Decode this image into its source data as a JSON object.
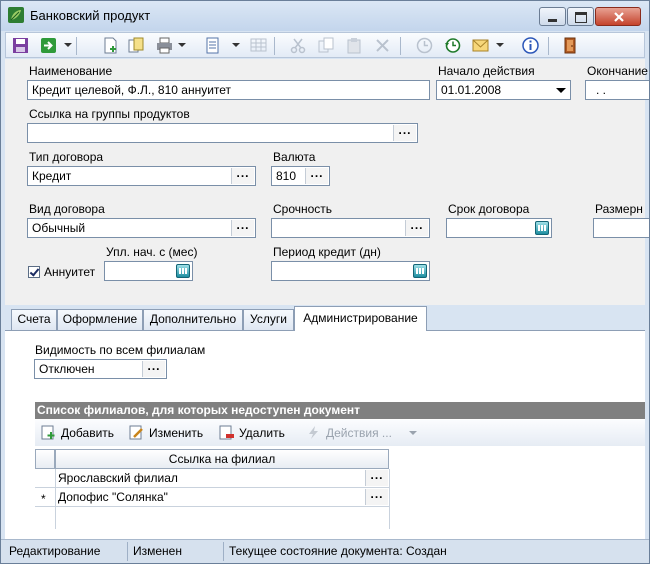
{
  "window": {
    "title": "Банковский продукт",
    "icon": "bank-product-leaf-icon"
  },
  "toolbar": {
    "icons": [
      "save-icon",
      "execute-icon",
      "new-document-icon",
      "copy-document-icon",
      "print-icon",
      "document-icon",
      "grid-icon",
      "cut-icon",
      "copy-icon",
      "paste-icon",
      "delete-icon",
      "clock-icon",
      "history-icon",
      "mail-icon",
      "info-icon",
      "exit-icon"
    ]
  },
  "form": {
    "name_label": "Наименование",
    "name_value": "Кредит целевой, Ф.Л., 810 аннуитет",
    "start_label": "Начало действия",
    "start_value": "01.01.2008",
    "end_label": "Окончание",
    "end_value": ". .",
    "groups_label": "Ссылка на группы продуктов",
    "groups_value": "",
    "contract_type_label": "Тип договора",
    "contract_type_value": "Кредит",
    "currency_label": "Валюта",
    "currency_value": "810",
    "contract_kind_label": "Вид договора",
    "contract_kind_value": "Обычный",
    "urgency_label": "Срочность",
    "urgency_value": "",
    "term_label": "Срок договора",
    "size_label": "Размерн",
    "annuity_label": "Аннуитет",
    "annuity_checked": true,
    "payment_start_label": "Упл. нач. с (мес)",
    "credit_period_label": "Период кредит (дн)",
    "ellipsis": "..."
  },
  "tabs": [
    {
      "label": "Счета",
      "active": false
    },
    {
      "label": "Оформление",
      "active": false
    },
    {
      "label": "Дополнительно",
      "active": false
    },
    {
      "label": "Услуги",
      "active": false
    },
    {
      "label": "Администрирование",
      "active": true
    }
  ],
  "admin": {
    "visibility_label": "Видимость по всем филиалам",
    "visibility_value": "Отключен",
    "branch_list_header": "Список филиалов, для которых недоступен документ",
    "add_label": "Добавить",
    "edit_label": "Изменить",
    "delete_label": "Удалить",
    "actions_label": "Действия ...",
    "column_header": "Ссылка на филиал",
    "rows": [
      {
        "marker": "",
        "value": "Ярославский филиал"
      },
      {
        "marker": "*",
        "value": "Допофис \"Солянка\""
      }
    ]
  },
  "status": {
    "mode": "Редактирование",
    "changed": "Изменен",
    "state": "Текущее состояние документа: Создан"
  },
  "colors": {
    "group_header_bg": "#808080",
    "window_frame": "#d8e4f2",
    "form_bg": "#f0f0f0"
  }
}
